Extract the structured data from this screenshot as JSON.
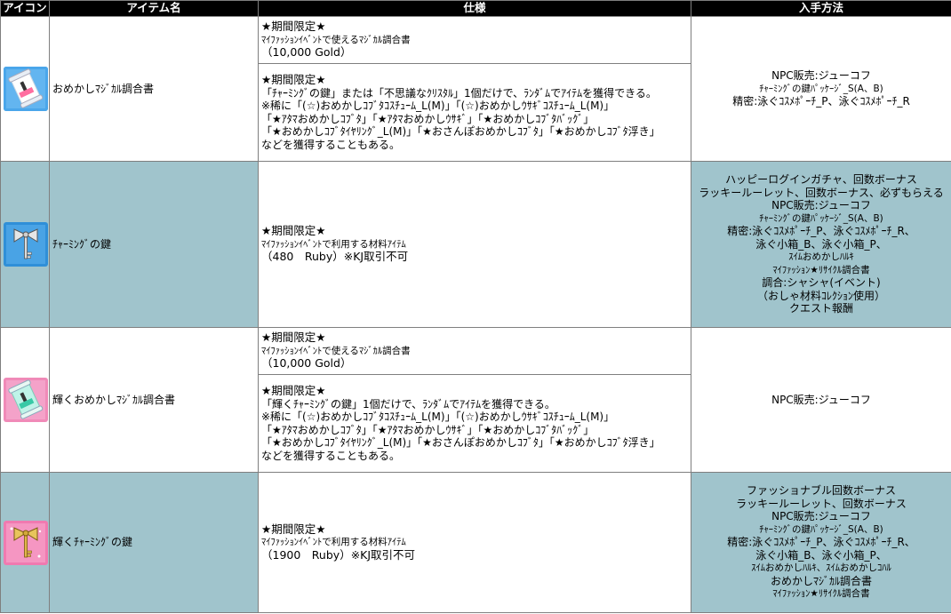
{
  "headers": {
    "icon": "アイコン",
    "name": "アイテム名",
    "spec": "仕様",
    "obtain": "入手方法"
  },
  "items": [
    {
      "icon": "magic-scroll-blue-icon",
      "name": "おめかしﾏｼﾞｶﾙ調合書",
      "spec_a": [
        "★期間限定★",
        "ﾏｲﾌｧｯｼｮﾝｲﾍﾞﾝﾄで使えるﾏｼﾞｶﾙ調合書",
        "（10,000 Gold）"
      ],
      "spec_b": [
        "★期間限定★",
        "「ﾁｬｰﾐﾝｸﾞの鍵」または「不思議なｸﾘｽﾀﾙ」1個だけで、ﾗﾝﾀﾞﾑでｱｲﾃﾑを獲得できる。",
        "※稀に「(☆)おめかしｺﾌﾞﾀｺｽﾁｭｰﾑ_L(M)」「(☆)おめかしｳｻｷﾞｺｽﾁｭｰﾑ_L(M)」",
        "「★ｱﾀﾏおめかしｺﾌﾞﾀ」「★ｱﾀﾏおめかしｳｻｷﾞ」「★おめかしｺﾌﾞﾀﾊﾞｯｸﾞ」",
        "「★おめかしｺﾌﾞﾀｲﾔﾘﾝｸﾞ_L(M)」「★おさんぽおめかしｺﾌﾞﾀ」「★おめかしｺﾌﾞﾀ浮き」",
        "などを獲得することもある。"
      ],
      "obtain": [
        "NPC販売:ジューコフ",
        "ﾁｬｰﾐﾝｸﾞの鍵ﾊﾟｯｹｰｼﾞ_S(A、B)",
        "精密:泳ぐｺｽﾒﾎﾟｰﾁ_P、泳ぐｺｽﾒﾎﾟｰﾁ_R"
      ]
    },
    {
      "icon": "charming-key-silver-icon",
      "name": "ﾁｬｰﾐﾝｸﾞの鍵",
      "spec": [
        "★期間限定★",
        "ﾏｲﾌｧｯｼｮﾝｲﾍﾞﾝﾄで利用する材料ｱｲﾃﾑ",
        "（480　Ruby）※KJ取引不可"
      ],
      "obtain": [
        "ハッピーログインガチャ、回数ボーナス",
        "ラッキールーレット、回数ボーナス、必ずもらえる",
        "NPC販売:ジューコフ",
        "ﾁｬｰﾐﾝｸﾞの鍵ﾊﾟｯｹｰｼﾞ_S(A、B)",
        "精密:泳ぐｺｽﾒﾎﾟｰﾁ_P、泳ぐｺｽﾒﾎﾟｰﾁ_R、",
        "泳ぐ小箱_B、泳ぐ小箱_P、",
        "ｽｲﾑおめかしﾊﾙｷ",
        "ﾏｲﾌｧｯｼｮﾝ★ﾘｻｲｸﾙ調合書",
        "調合:シャシャ(イベント)",
        "（おしゃ材料ｺﾚｸｼｮﾝ使用）",
        "クエスト報酬"
      ]
    },
    {
      "icon": "magic-scroll-pink-icon",
      "name": "輝くおめかしﾏｼﾞｶﾙ調合書",
      "spec_a": [
        "★期間限定★",
        "ﾏｲﾌｧｯｼｮﾝｲﾍﾞﾝﾄで使えるﾏｼﾞｶﾙ調合書",
        "（10,000 Gold）"
      ],
      "spec_b": [
        "★期間限定★",
        "「輝くﾁｬｰﾐﾝｸﾞの鍵」1個だけで、ﾗﾝﾀﾞﾑでｱｲﾃﾑを獲得できる。",
        "※稀に「(☆)おめかしｺﾌﾞﾀｺｽﾁｭｰﾑ_L(M)」「(☆)おめかしｳｻｷﾞｺｽﾁｭｰﾑ_L(M)」",
        "「★ｱﾀﾏおめかしｺﾌﾞﾀ」「★ｱﾀﾏおめかしｳｻｷﾞ」「★おめかしｺﾌﾞﾀﾊﾞｯｸﾞ」",
        "「★おめかしｺﾌﾞﾀｲﾔﾘﾝｸﾞ_L(M)」「★おさんぽおめかしｺﾌﾞﾀ」「★おめかしｺﾌﾞﾀ浮き」",
        "などを獲得することもある。"
      ],
      "obtain": [
        "NPC販売:ジューコフ"
      ]
    },
    {
      "icon": "charming-key-gold-icon",
      "name": "輝くﾁｬｰﾐﾝｸﾞの鍵",
      "spec": [
        "★期間限定★",
        "ﾏｲﾌｧｯｼｮﾝｲﾍﾞﾝﾄで利用する材料ｱｲﾃﾑ",
        "（1900　Ruby）※KJ取引不可"
      ],
      "obtain": [
        "ファッショナブル回数ボーナス",
        "ラッキールーレット、回数ボーナス",
        "NPC販売:ジューコフ",
        "ﾁｬｰﾐﾝｸﾞの鍵ﾊﾟｯｹｰｼﾞ_S(A、B)",
        "精密:泳ぐｺｽﾒﾎﾟｰﾁ_P、泳ぐｺｽﾒﾎﾟｰﾁ_R、",
        "泳ぐ小箱_B、泳ぐ小箱_P、",
        "ｽｲﾑおめかしﾊﾙｷ、ｽｲﾑおめかしｺﾊﾙ",
        "おめかしﾏｼﾞｶﾙ調合書",
        "ﾏｲﾌｧｯｼｮﾝ★ﾘｻｲｸﾙ調合書"
      ]
    }
  ]
}
